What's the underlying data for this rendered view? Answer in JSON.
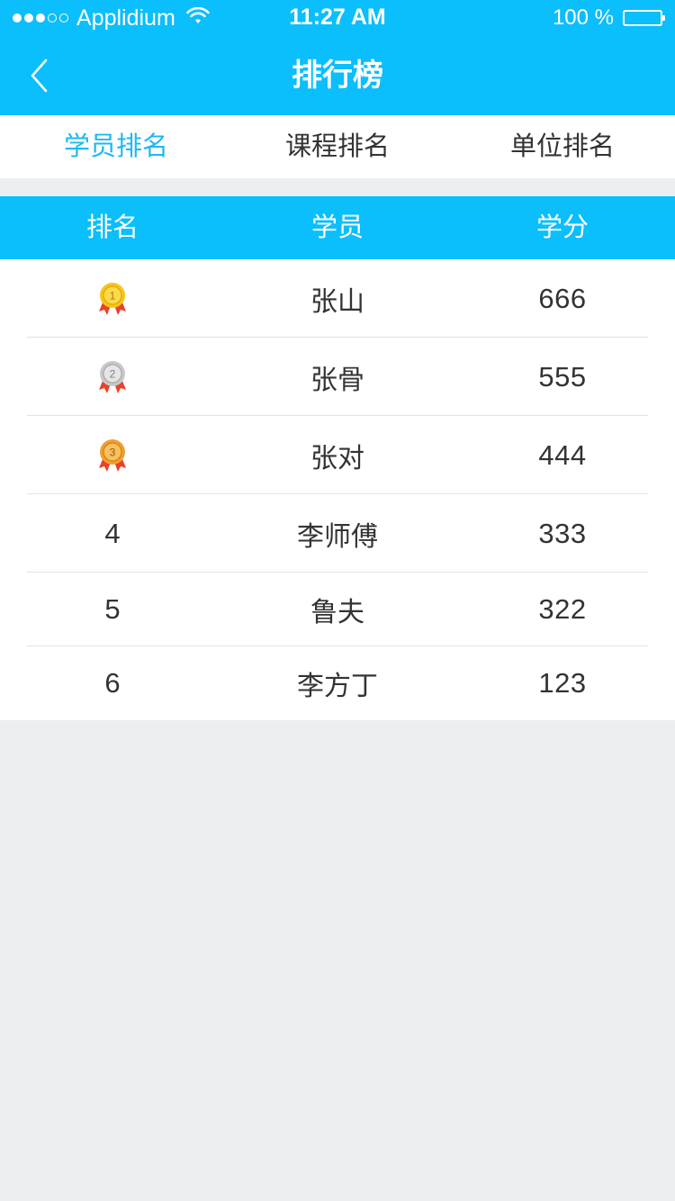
{
  "status_bar": {
    "carrier": "Applidium",
    "time": "11:27 AM",
    "battery": "100 %",
    "signal_filled": 3,
    "signal_total": 5
  },
  "nav": {
    "title": "排行榜",
    "back_icon": "chevron-left-icon"
  },
  "tabs": [
    {
      "label": "学员排名",
      "active": true
    },
    {
      "label": "课程排名",
      "active": false
    },
    {
      "label": "单位排名",
      "active": false
    }
  ],
  "table": {
    "headers": [
      "排名",
      "学员",
      "学分"
    ],
    "rows": [
      {
        "rank": "1",
        "medal": "gold-medal-icon",
        "name": "张山",
        "score": "666"
      },
      {
        "rank": "2",
        "medal": "silver-medal-icon",
        "name": "张骨",
        "score": "555"
      },
      {
        "rank": "3",
        "medal": "bronze-medal-icon",
        "name": "张对",
        "score": "444"
      },
      {
        "rank": "4",
        "medal": null,
        "name": "李师傅",
        "score": "333"
      },
      {
        "rank": "5",
        "medal": null,
        "name": "鲁夫",
        "score": "322"
      },
      {
        "rank": "6",
        "medal": null,
        "name": "李方丁",
        "score": "123"
      }
    ]
  },
  "colors": {
    "primary": "#0BBEFC",
    "active_tab": "#1DB8F4",
    "background": "#EBEFF2",
    "gold": "#F5C518",
    "silver": "#C8C8C8",
    "bronze": "#F0A030",
    "ribbon": "#E8412C"
  }
}
